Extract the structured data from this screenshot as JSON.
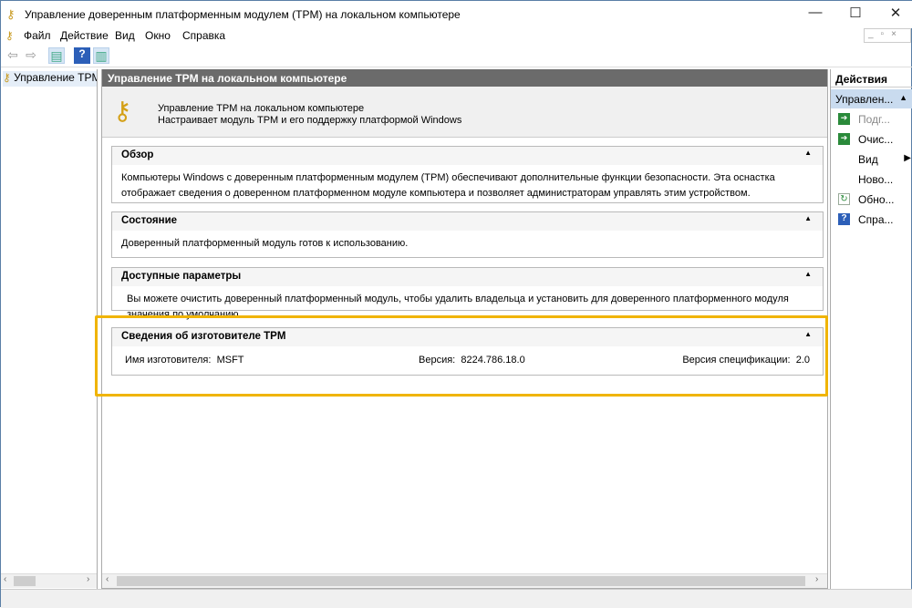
{
  "window": {
    "title": "Управление доверенным платформенным модулем (TPM) на локальном компьютере"
  },
  "menu": [
    "Файл",
    "Действие",
    "Вид",
    "Окно",
    "Справка"
  ],
  "tree": {
    "item": "Управление TPM"
  },
  "center": {
    "header": "Управление TPM на локальном компьютере",
    "intro_title": "Управление TPM на локальном компьютере",
    "intro_desc": "Настраивает модуль TPM и его поддержку платформой Windows",
    "sections": [
      {
        "title": "Обзор",
        "body": "Компьютеры Windows с доверенным платформенным модулем (TPM) обеспечивают дополнительные функции безопасности. Эта оснастка отображает сведения о доверенном платформенном модуле компьютера и позволяет администраторам управлять этим устройством."
      },
      {
        "title": "Состояние",
        "body": "Доверенный платформенный модуль готов к использованию."
      },
      {
        "title": "Доступные параметры",
        "body": "Вы можете очистить доверенный платформенный модуль, чтобы удалить владельца и установить для доверенного платформенного модуля значения по умолчанию."
      },
      {
        "title": "Сведения об изготовителе TPM",
        "manufacturer_label": "Имя изготовителя:",
        "manufacturer": "MSFT",
        "version_label": "Версия:",
        "version": "8224.786.18.0",
        "spec_label": "Версия спецификации:",
        "spec": "2.0"
      }
    ]
  },
  "actions": {
    "header": "Действия",
    "group": "Управлен...",
    "items": [
      {
        "label": "Подг...",
        "icon": "green-arrow-icon",
        "disabled": true
      },
      {
        "label": "Очис...",
        "icon": "green-arrow-icon"
      },
      {
        "label": "Вид",
        "icon": "none",
        "submenu": true
      },
      {
        "label": "Ново...",
        "icon": "none"
      },
      {
        "label": "Обно...",
        "icon": "refresh-icon"
      },
      {
        "label": "Спра...",
        "icon": "help-icon"
      }
    ]
  },
  "colors": {
    "highlight": "#f0b400",
    "header": "#6b6b6b",
    "selected": "#c9dbef"
  }
}
